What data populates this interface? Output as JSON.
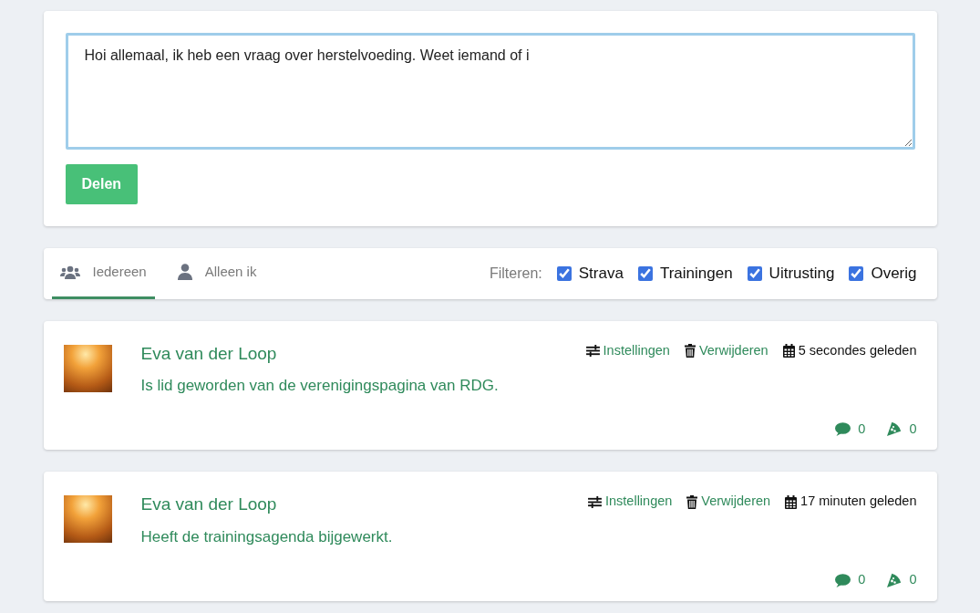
{
  "composer": {
    "value": "Hoi allemaal, ik heb een vraag over herstelvoeding. Weet iemand of i",
    "button": "Delen"
  },
  "tabs": [
    {
      "label": "Iedereen",
      "kind": "group",
      "selected": true
    },
    {
      "label": "Alleen ik",
      "kind": "user",
      "selected": false
    }
  ],
  "filter": {
    "label": "Filteren:",
    "options": [
      {
        "label": "Strava",
        "checked": true
      },
      {
        "label": "Trainingen",
        "checked": true
      },
      {
        "label": "Uitrusting",
        "checked": true
      },
      {
        "label": "Overig",
        "checked": true
      }
    ]
  },
  "posts": [
    {
      "author": "Eva van der Loop",
      "text": "Is lid geworden van de verenigingspagina van RDG.",
      "settings": "Instellingen",
      "delete": "Verwijderen",
      "time": "5 secondes geleden",
      "comments": "0",
      "slices": "0"
    },
    {
      "author": "Eva van der Loop",
      "text": "Heeft de trainingsagenda bijgewerkt.",
      "settings": "Instellingen",
      "delete": "Verwijderen",
      "time": "17 minuten geleden",
      "comments": "0",
      "slices": "0"
    }
  ]
}
